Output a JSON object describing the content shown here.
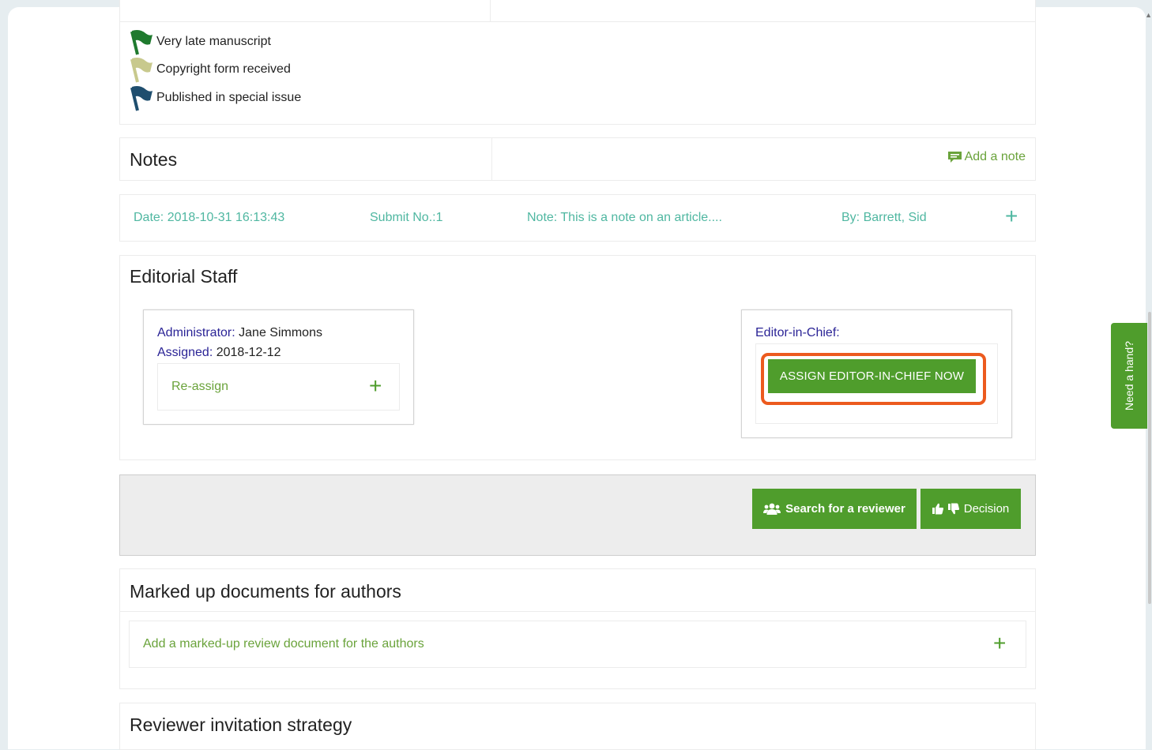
{
  "flags": [
    {
      "label": "Very late manuscript",
      "icon": "flag-icon",
      "color": "#1f7a2e"
    },
    {
      "label": "Copyright form received",
      "icon": "flag-icon",
      "color": "#c8c98d"
    },
    {
      "label": "Published in special issue",
      "icon": "flag-icon",
      "color": "#1f4e6e"
    }
  ],
  "notes": {
    "title": "Notes",
    "add_label": "Add a note",
    "row": {
      "date": "Date: 2018-10-31 16:13:43",
      "submit": "Submit No.:1",
      "note": "Note: This is a note on an article....",
      "by": "By: Barrett, Sid",
      "expand": "+"
    }
  },
  "editorial_staff": {
    "title": "Editorial Staff",
    "administrator_label": "Administrator:",
    "administrator_name": "Jane Simmons",
    "assigned_label": "Assigned:",
    "assigned_date": "2018-12-12",
    "reassign_label": "Re-assign",
    "reassign_plus": "+",
    "eic_label": "Editor-in-Chief:",
    "assign_button": "ASSIGN EDITOR-IN-CHIEF NOW"
  },
  "actions": {
    "search_reviewer": "Search for a reviewer",
    "decision": "Decision"
  },
  "marked_up": {
    "title": "Marked up documents for authors",
    "add_label": "Add a marked-up review document for the authors",
    "plus": "+"
  },
  "reviewer_strategy": {
    "title": "Reviewer invitation strategy"
  },
  "help_tab": "Need a hand?",
  "colors": {
    "accent_green": "#4f9d2c",
    "link_green": "#6aa33b",
    "teal": "#4fb7a1",
    "label_blue": "#2b2496",
    "highlight_orange": "#ec5a1e"
  }
}
